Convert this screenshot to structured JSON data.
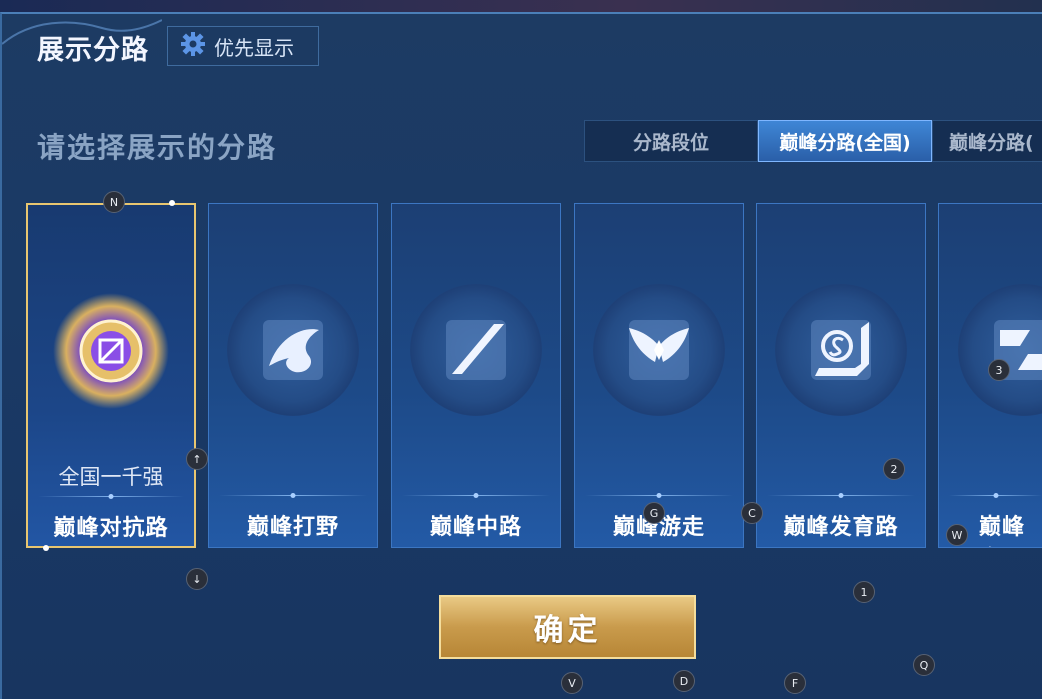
{
  "header": {
    "title": "展示分路",
    "priority_button": {
      "label": "优先显示",
      "icon": "gear-icon"
    }
  },
  "main": {
    "subtitle": "请选择展示的分路",
    "tabs": [
      {
        "label": "分路段位",
        "active": false
      },
      {
        "label": "巅峰分路(全国)",
        "active": true
      },
      {
        "label": "巅峰分路(",
        "active": false
      }
    ],
    "cards": [
      {
        "name": "巅峰对抗路",
        "rank": "全国一千强",
        "selected": true,
        "icon": "medal-emblem-icon"
      },
      {
        "name": "巅峰打野",
        "rank": "",
        "selected": false,
        "icon": "dragon-emblem-icon"
      },
      {
        "name": "巅峰中路",
        "rank": "",
        "selected": false,
        "icon": "slash-emblem-icon"
      },
      {
        "name": "巅峰游走",
        "rank": "",
        "selected": false,
        "icon": "wings-emblem-icon"
      },
      {
        "name": "巅峰发育路",
        "rank": "",
        "selected": false,
        "icon": "s-emblem-icon"
      },
      {
        "name": "巅峰全",
        "rank": "",
        "selected": false,
        "icon": "shuriken-emblem-icon"
      }
    ],
    "confirm_label": "确定"
  },
  "markers": [
    "N",
    "↑",
    "↓",
    "G",
    "C",
    "2",
    "3",
    "W",
    "1",
    "Q",
    "V",
    "D",
    "F"
  ],
  "colors": {
    "accent_gold": "#e8c670",
    "active_tab": "#3f86d6",
    "panel_blue": "#1a3a66"
  }
}
